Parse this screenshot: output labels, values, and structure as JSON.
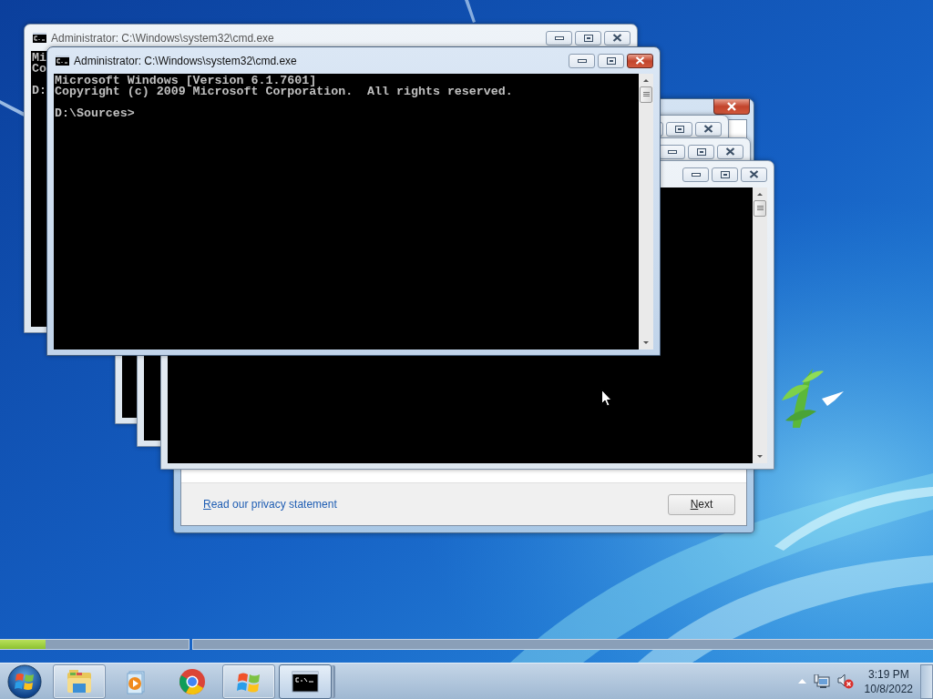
{
  "setup_dialog": {
    "privacy_link": "Read our privacy statement",
    "next_button": "Next"
  },
  "setup_progress": [
    {
      "level": 0.24
    },
    {
      "level": 0
    }
  ],
  "console_windows": [
    {
      "title": "Administrator: C:\\Windows\\system32\\cmd.exe",
      "active": false,
      "paragraphs": [
        [
          "Mi",
          "Co"
        ],
        [
          "D:"
        ]
      ]
    },
    {
      "title": "Administrator: C:\\Windows\\system32\\cmd.exe",
      "active": true,
      "paragraphs": [
        [
          "Microsoft Windows [Version 6.1.7601]",
          "Copyright (c) 2009 Microsoft Corporation.  All rights reserved."
        ],
        [
          "D:\\Sources>"
        ]
      ]
    }
  ],
  "taskbar": {
    "items": [
      {
        "kind": "folder",
        "running": true,
        "selected": false
      },
      {
        "kind": "media",
        "running": false,
        "selected": false
      },
      {
        "kind": "browser",
        "running": false,
        "selected": false
      },
      {
        "kind": "flag",
        "running": true,
        "selected": false
      },
      {
        "kind": "terminal",
        "running": true,
        "selected": true
      }
    ],
    "tray": {
      "time": "3:19 PM",
      "date": "10/8/2022"
    }
  }
}
